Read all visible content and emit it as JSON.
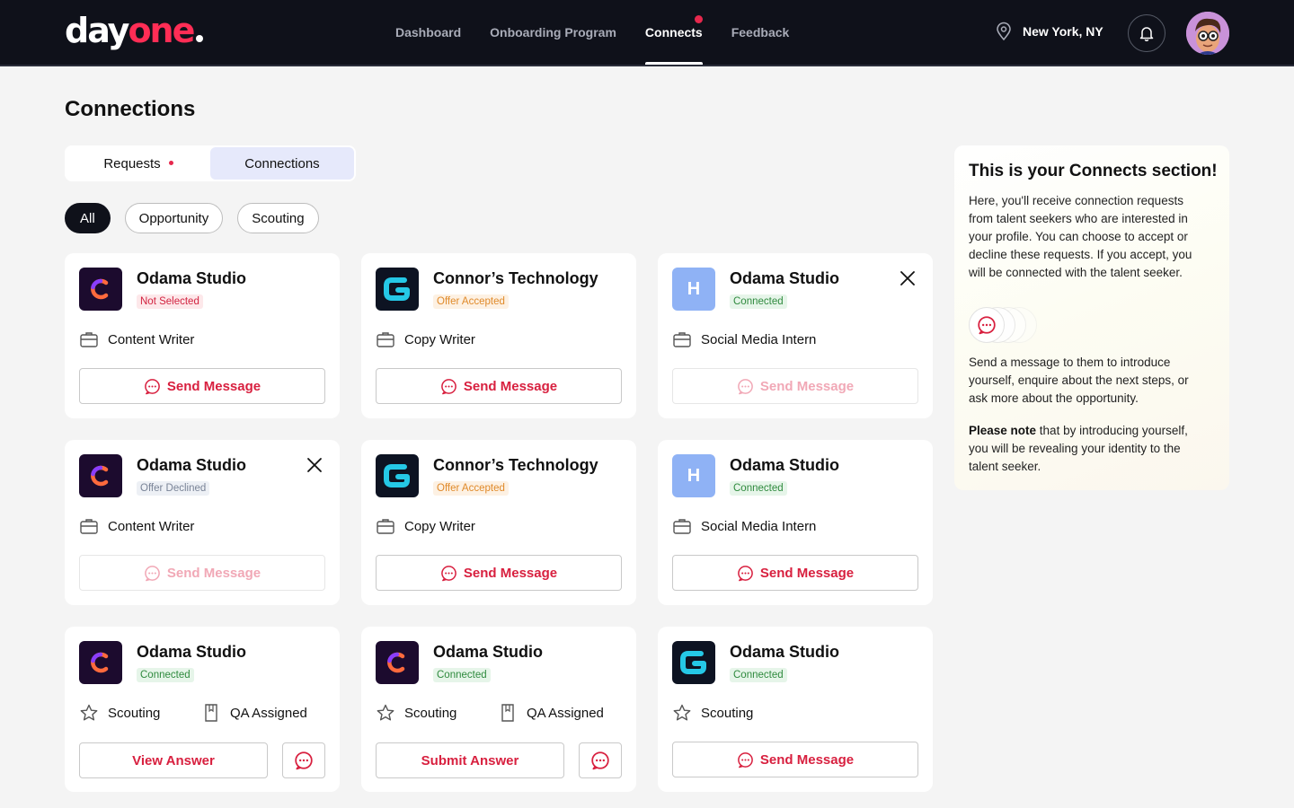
{
  "brand": {
    "part1": "day",
    "part2": "one"
  },
  "nav": {
    "items": [
      {
        "label": "Dashboard",
        "active": false
      },
      {
        "label": "Onboarding Program",
        "active": false
      },
      {
        "label": "Connects",
        "active": true
      },
      {
        "label": "Feedback",
        "active": false
      }
    ],
    "location": "New York, NY"
  },
  "page": {
    "title": "Connections",
    "tabs": [
      "Requests",
      "Connections"
    ],
    "active_tab": "Connections",
    "filters": [
      "All",
      "Opportunity",
      "Scouting"
    ],
    "active_filter": "All"
  },
  "cards": [
    {
      "name": "Odama Studio",
      "status": "Not Selected",
      "role": "Content Writer",
      "action": "Send Message"
    },
    {
      "name": "Connor’s Technology",
      "status": "Offer Accepted",
      "role": "Copy Writer",
      "action": "Send Message"
    },
    {
      "name": "Odama Studio",
      "status": "Connected",
      "role": "Social Media Intern",
      "action": "Send Message",
      "logo_letter": "H"
    },
    {
      "name": "Odama Studio",
      "status": "Offer Declined",
      "role": "Content Writer",
      "action": "Send Message"
    },
    {
      "name": "Connor’s Technology",
      "status": "Offer Accepted",
      "role": "Copy Writer",
      "action": "Send Message"
    },
    {
      "name": "Odama Studio",
      "status": "Connected",
      "role": "Social Media Intern",
      "action": "Send Message",
      "logo_letter": "H"
    },
    {
      "name": "Odama Studio",
      "status": "Connected",
      "role": "Scouting",
      "role2": "QA Assigned",
      "action": "View Answer"
    },
    {
      "name": "Odama Studio",
      "status": "Connected",
      "role": "Scouting",
      "role2": "QA Assigned",
      "action": "Submit Answer"
    },
    {
      "name": "Odama Studio",
      "status": "Connected",
      "role": "Scouting",
      "action": "Send Message"
    }
  ],
  "info": {
    "title": "This is your Connects section!",
    "p1": "Here, you'll receive connection requests from talent seekers who are  interested in your profile. You can choose to accept or decline these  requests. If you accept, you will be connected with the talent seeker.",
    "p2": "Send a message to them to introduce yourself, enquire about the next steps,  or ask more about the opportunity.",
    "p3_bold": "Please note",
    "p3_rest": " that by introducing  yourself, you will be revealing your identity to the talent seeker."
  },
  "colors": {
    "accent": "#d8203f",
    "nav_bg": "#0f111a"
  },
  "icons": [
    "location-pin-icon",
    "bell-icon",
    "briefcase-icon",
    "star-icon",
    "bookmark-icon",
    "message-icon",
    "close-icon"
  ]
}
